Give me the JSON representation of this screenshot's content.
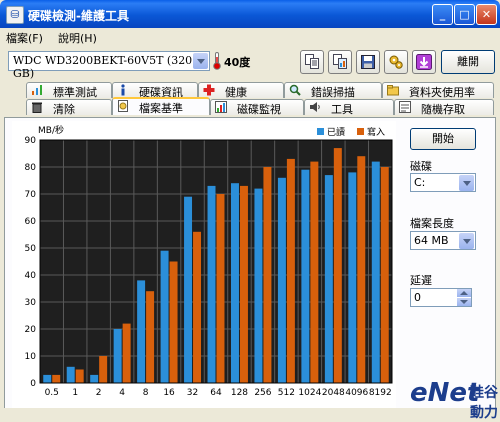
{
  "window": {
    "title": "硬碟檢測-維護工具"
  },
  "menu": {
    "items": [
      "檔案(F)",
      "說明(H)"
    ]
  },
  "toolbar": {
    "drive_selected": "WDC WD3200BEKT-60V5T (320 GB)",
    "temperature": "40度",
    "exit_label": "離開",
    "tool_icons": [
      "copy-text-icon",
      "copy-image-icon",
      "save-icon",
      "settings-icon",
      "download-icon"
    ]
  },
  "tabs": {
    "row1": [
      "標準測試",
      "硬碟資訊",
      "健康",
      "錯誤掃描",
      "資料夾使用率"
    ],
    "row2": [
      "清除",
      "檔案基準",
      "磁碟監視",
      "工具",
      "隨機存取"
    ],
    "active": "檔案基準"
  },
  "controls": {
    "start_label": "開始",
    "drive_label": "磁碟",
    "drive_value": "C:",
    "file_length_label": "檔案長度",
    "file_length_value": "64 MB",
    "delay_label": "延遲",
    "delay_value": "0"
  },
  "colors": {
    "read": "#2B8FD9",
    "write": "#D8600C",
    "plot_bg": "#1F1F1F",
    "grid": "#5A5A5A"
  },
  "watermark": {
    "text": "eNet",
    "cn": "硅谷動力"
  },
  "chart_data": {
    "type": "bar",
    "ylabel": "MB/秒",
    "ylim": [
      0,
      90
    ],
    "yticks": [
      0,
      10,
      20,
      30,
      40,
      50,
      60,
      70,
      80,
      90
    ],
    "categories": [
      "0.5",
      "1",
      "2",
      "4",
      "8",
      "16",
      "32",
      "64",
      "128",
      "256",
      "512",
      "1024",
      "2048",
      "4096",
      "8192"
    ],
    "series": [
      {
        "name": "已讀",
        "values": [
          3,
          6,
          3,
          20,
          38,
          49,
          69,
          73,
          74,
          72,
          76,
          79,
          77,
          78,
          82
        ]
      },
      {
        "name": "寫入",
        "values": [
          3,
          5,
          10,
          22,
          34,
          45,
          56,
          70,
          73,
          80,
          83,
          82,
          87,
          84,
          80
        ]
      }
    ],
    "legend": "top-right",
    "grid": true
  }
}
